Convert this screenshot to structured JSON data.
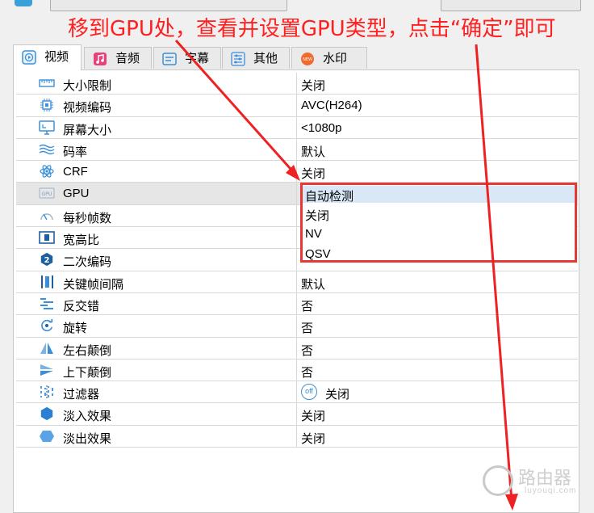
{
  "annotation": {
    "instruction": "移到GPU处，查看并设置GPU类型，点击“确定”即可",
    "color": "#ff1f1f"
  },
  "tabs": [
    {
      "label": "视频",
      "icon": "video-icon",
      "active": true
    },
    {
      "label": "音频",
      "icon": "music-icon",
      "active": false
    },
    {
      "label": "字幕",
      "icon": "subtitle-icon",
      "active": false
    },
    {
      "label": "其他",
      "icon": "sliders-icon",
      "active": false
    },
    {
      "label": "水印",
      "icon": "new-badge-icon",
      "active": false
    }
  ],
  "settings": [
    {
      "label": "大小限制",
      "value": "关闭",
      "icon": "ruler-icon"
    },
    {
      "label": "视频编码",
      "value": "AVC(H264)",
      "icon": "chip-icon"
    },
    {
      "label": "屏幕大小",
      "value": "<1080p",
      "icon": "monitor-icon"
    },
    {
      "label": "码率",
      "value": "默认",
      "icon": "wave-icon"
    },
    {
      "label": "CRF",
      "value": "关闭",
      "icon": "atom-icon"
    },
    {
      "label": "GPU",
      "value": "自动检测",
      "icon": "gpu-icon"
    },
    {
      "label": "每秒帧数",
      "value": "",
      "icon": "gauge-icon"
    },
    {
      "label": "宽高比",
      "value": "",
      "icon": "aspect-icon"
    },
    {
      "label": "二次编码",
      "value": "",
      "icon": "two-hex-icon"
    },
    {
      "label": "关键帧间隔",
      "value": "默认",
      "icon": "keyframe-icon"
    },
    {
      "label": "反交错",
      "value": "否",
      "icon": "deinterlace-icon"
    },
    {
      "label": "旋转",
      "value": "否",
      "icon": "rotate-icon"
    },
    {
      "label": "左右颠倒",
      "value": "否",
      "icon": "flip-horizontal-icon"
    },
    {
      "label": "上下颠倒",
      "value": "否",
      "icon": "flip-vertical-icon"
    },
    {
      "label": "过滤器",
      "value": "关闭",
      "icon": "filter-icon",
      "toggle_label": "off"
    },
    {
      "label": "淡入效果",
      "value": "关闭",
      "icon": "fade-in-icon"
    },
    {
      "label": "淡出效果",
      "value": "关闭",
      "icon": "fade-out-icon"
    }
  ],
  "gpu_dropdown": {
    "options": [
      "自动检测",
      "关闭",
      "NV",
      "QSV"
    ],
    "selected": "自动检测",
    "border_color": "#e53935"
  },
  "watermark": {
    "text": "路由器",
    "url": "luyouqi.com"
  }
}
